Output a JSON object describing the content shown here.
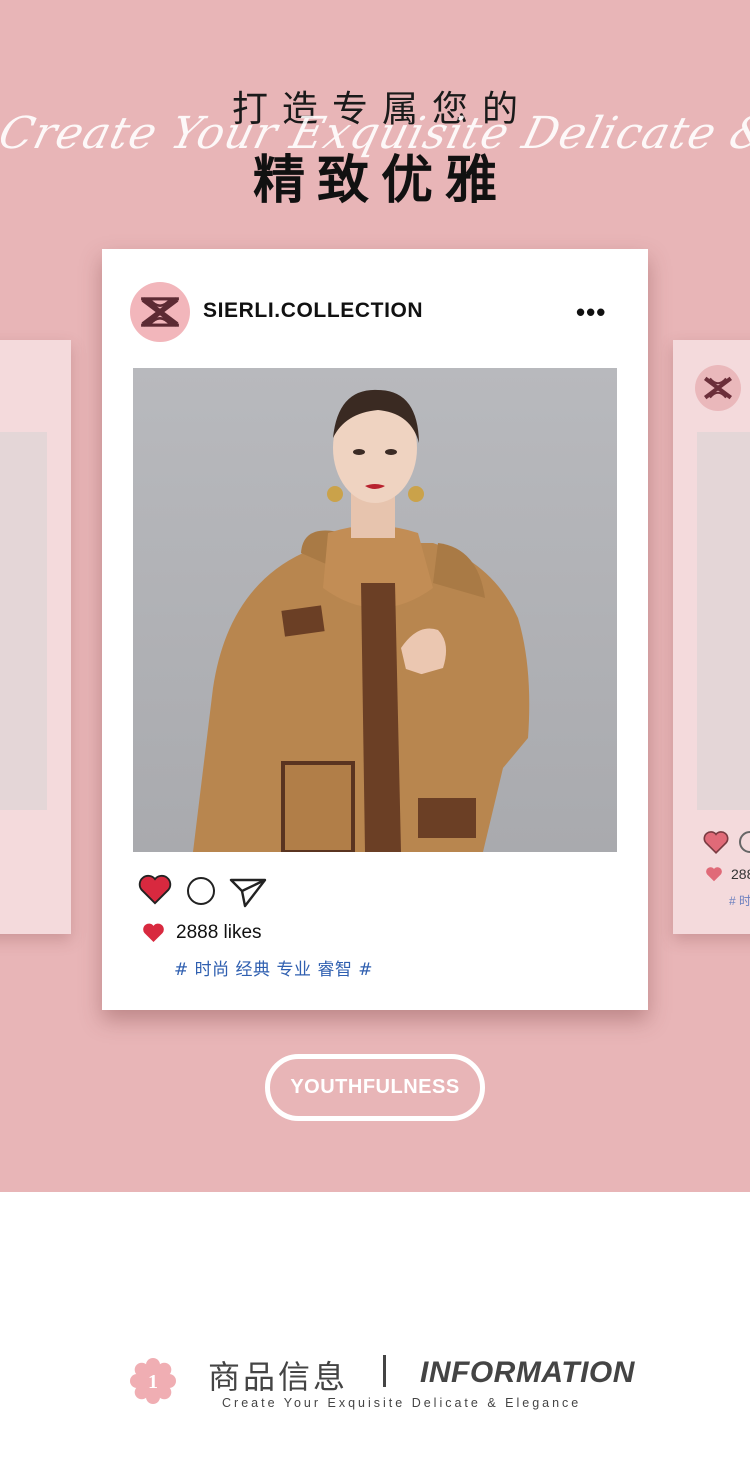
{
  "header": {
    "title_top": "打造专属您的",
    "script_text": "Create Your Exquisite Delicate & Elegance",
    "title_main": "精致优雅"
  },
  "post": {
    "username": "SIERLI.COLLECTION",
    "more_icon": "•••",
    "likes": "2888 likes",
    "tags": "# 时尚 经典 专业 睿智 #"
  },
  "ghost_right": {
    "likes": "288",
    "tags": "# 时"
  },
  "pill_label": "YOUTHFULNESS",
  "info": {
    "number": "1",
    "title_cn": "商品信息",
    "title_en": "INFORMATION",
    "subtitle": "Create Your Exquisite Delicate & Elegance"
  },
  "colors": {
    "background": "#e8b5b7",
    "heart": "#d8293f",
    "tags": "#2f5fb0",
    "logo_bg": "#f2b6bb"
  },
  "icons": [
    "logo-monogram-icon",
    "more-icon",
    "heart-icon",
    "comment-icon",
    "send-icon",
    "flower-badge-icon"
  ]
}
